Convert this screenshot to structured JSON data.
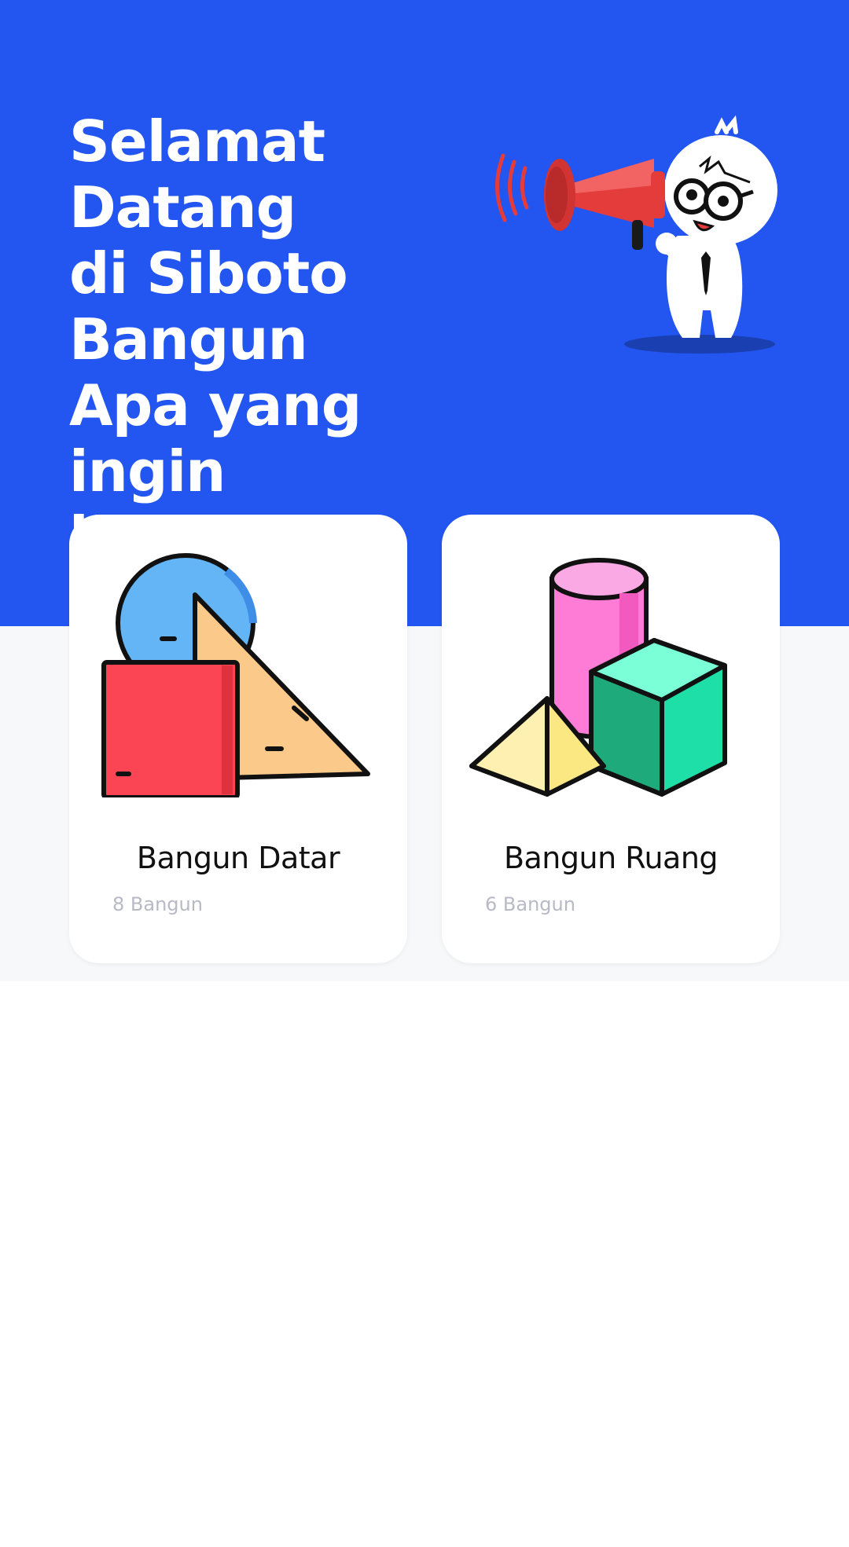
{
  "header": {
    "line1": "Selamat Datang",
    "line2": "di Siboto",
    "line3": "Bangun",
    "line4": "Apa yang ingin",
    "line5": "kamu pelajari?",
    "background_color": "#2356F0"
  },
  "categories": [
    {
      "title": "Bangun Datar",
      "count": "8 Bangun",
      "icon": "flat-shapes-icon"
    },
    {
      "title": "Bangun Ruang",
      "count": "6 Bangun",
      "icon": "solid-shapes-icon"
    }
  ],
  "mascot": {
    "icon": "mascot-megaphone-icon"
  }
}
